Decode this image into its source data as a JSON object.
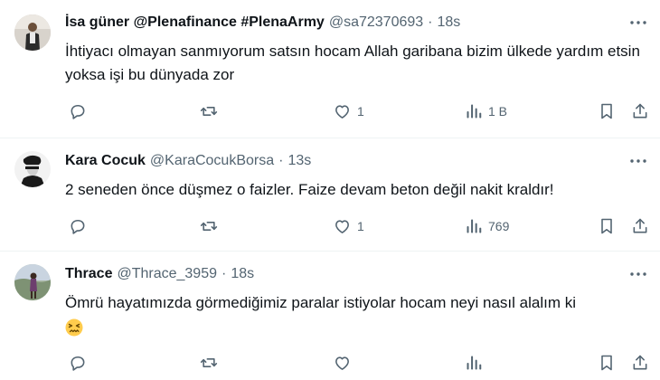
{
  "tweets": [
    {
      "name": "İsa güner @Plenafinance #PlenaArmy",
      "handle": "@sa72370693",
      "separator": "·",
      "time": "18s",
      "text": "İhtiyacı olmayan sanmıyorum satsın hocam Allah garibana bizim ülkede yardım etsin yoksa işi bu dünyada zor",
      "likes": "1",
      "views": "1 B",
      "replies": "",
      "reposts": ""
    },
    {
      "name": "Kara Cocuk",
      "handle": "@KaraCocukBorsa",
      "separator": "·",
      "time": "13s",
      "text": "2 seneden önce düşmez o faizler. Faize devam beton değil nakit kraldır!",
      "likes": "1",
      "views": "769",
      "replies": "",
      "reposts": ""
    },
    {
      "name": "Thrace",
      "handle": "@Thrace_3959",
      "separator": "·",
      "time": "18s",
      "text": "Ömrü hayatımızda görmediğimiz paralar istiyolar hocam neyi nasıl alalım ki",
      "emoji": "confounded-face",
      "likes": "",
      "views": "",
      "replies": "",
      "reposts": ""
    }
  ],
  "colors": {
    "text": "#0f1419",
    "secondary": "#536471",
    "divider": "#eff3f4"
  },
  "icons": [
    "more-icon",
    "reply-icon",
    "repost-icon",
    "like-icon",
    "views-icon",
    "bookmark-icon",
    "share-icon"
  ]
}
